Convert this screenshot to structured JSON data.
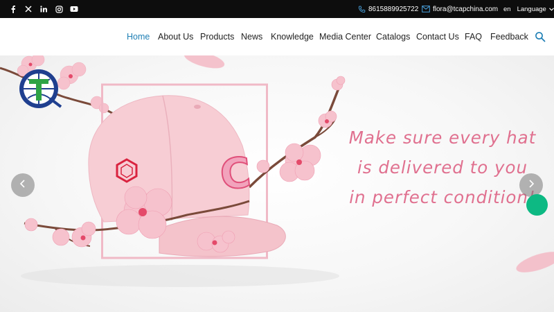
{
  "topbar": {
    "social_icons": [
      "facebook-icon",
      "x-twitter-icon",
      "linkedin-icon",
      "instagram-icon",
      "youtube-icon"
    ],
    "phone": "8615889925722",
    "email": "flora@tcapchina.com",
    "lang_code": "en",
    "lang_label": "Language"
  },
  "nav": {
    "items": [
      "Home",
      "About Us",
      "Products",
      "News",
      "Knowledge",
      "Media Center",
      "Catalogs",
      "Contact Us",
      "FAQ",
      "Feedback"
    ],
    "active": "Home",
    "active_color": "#1e7fb5"
  },
  "hero": {
    "slogan": [
      "Make sure every hat",
      "is delivered to you",
      "in perfect condition!"
    ],
    "slogan_color": "#e0708f",
    "cap_logo_letter": "C",
    "prev_icon": "chevron-left-icon",
    "next_icon": "chevron-right-icon",
    "chat_color": "#0db983"
  }
}
